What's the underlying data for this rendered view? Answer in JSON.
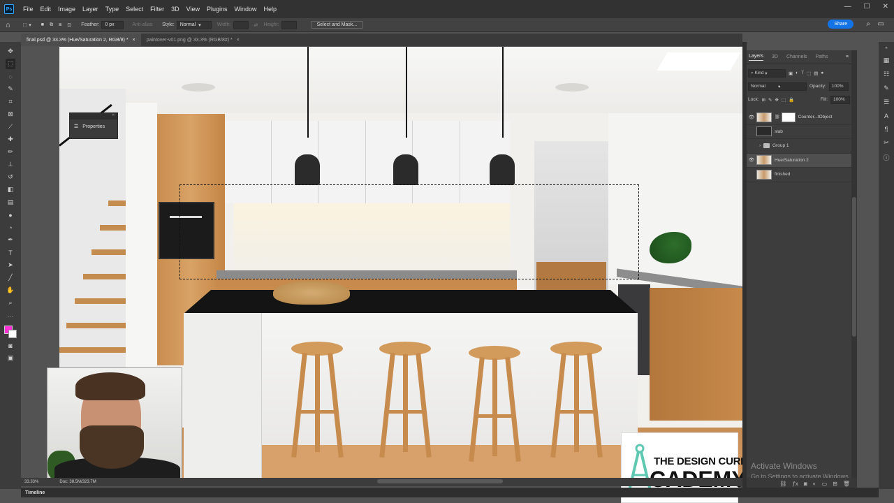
{
  "menu": {
    "items": [
      "File",
      "Edit",
      "Image",
      "Layer",
      "Type",
      "Select",
      "Filter",
      "3D",
      "View",
      "Plugins",
      "Window",
      "Help"
    ],
    "ps_logo": "Ps"
  },
  "options_bar": {
    "feather_label": "Feather:",
    "feather_value": "0 px",
    "anti_alias": "Anti-alias",
    "style_label": "Style:",
    "style_value": "Normal",
    "width_label": "Width:",
    "height_label": "Height:",
    "select_mask": "Select and Mask...",
    "share": "Share"
  },
  "tabs": [
    {
      "label": "final.psd @ 33.3% (Hue/Saturation 2, RGB/8) *",
      "close": "×"
    },
    {
      "label": "paintover-v01.png @ 33.3% (RGB/8#) *",
      "close": "×"
    }
  ],
  "properties_panel": {
    "label": "Properties",
    "collapse": "«"
  },
  "layers_panel": {
    "tabs": [
      "Layers",
      "3D",
      "Channels",
      "Paths"
    ],
    "kind": "Kind",
    "blend_mode": "Normal",
    "opacity_label": "Opacity:",
    "opacity_value": "100%",
    "lock_label": "Lock:",
    "fill_label": "Fill:",
    "fill_value": "100%",
    "layers": [
      {
        "name": "Counter...tObject",
        "visible": true,
        "type": "smart"
      },
      {
        "name": "slab",
        "visible": false,
        "type": "dark"
      },
      {
        "name": "Group 1",
        "visible": false,
        "type": "group"
      },
      {
        "name": "Hue/Saturation 2",
        "visible": true,
        "type": "image",
        "selected": true
      },
      {
        "name": "finished",
        "visible": false,
        "type": "image"
      }
    ]
  },
  "status": {
    "zoom": "33.33%",
    "doc": "Doc: 38.5M/323.7M"
  },
  "timeline": {
    "label": "Timeline"
  },
  "watermark": {
    "line1": "Activate Windows",
    "line2": "Go to Settings to activate Windows."
  },
  "logo": {
    "line1": "THE DESIGN CURE",
    "line2": "CADEMY"
  },
  "colors": {
    "foreground": "#ff2fd8",
    "background": "#ffffff",
    "accent": "#1473e6"
  }
}
